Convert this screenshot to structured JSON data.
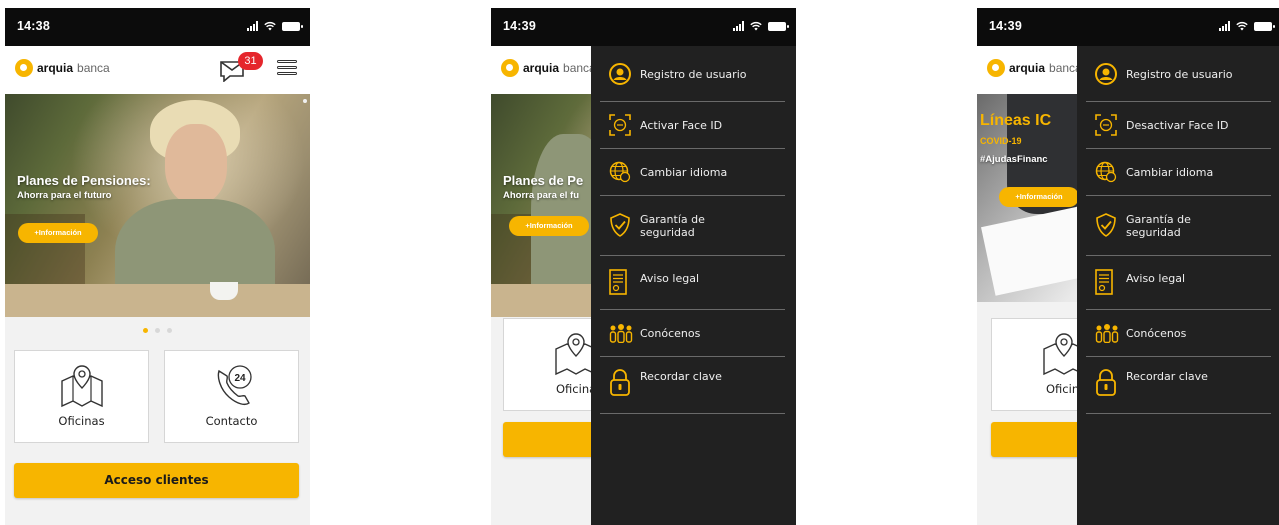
{
  "colors": {
    "accent": "#f7b500",
    "drawer": "#212121",
    "badge": "#e5262c"
  },
  "screens": [
    {
      "status_time": "14:38",
      "brand": {
        "bold": "arquia",
        "light": "banca"
      },
      "mail_badge": "31",
      "banner": {
        "title": "Planes de Pensiones:",
        "subtitle": "Ahorra para el futuro",
        "button": "+Información"
      },
      "tiles": [
        {
          "label": "Oficinas",
          "icon": "map-pin-icon"
        },
        {
          "label": "Contacto",
          "icon": "phone-24-icon"
        }
      ],
      "cta": "Acceso clientes"
    },
    {
      "status_time": "14:39",
      "brand": {
        "bold": "arquia",
        "light": "banca"
      },
      "banner": {
        "title": "Planes de Pe",
        "subtitle": "Ahorra para el fu",
        "button": "+Información"
      },
      "tiles": [
        {
          "label": "Oficinas"
        }
      ],
      "menu": [
        {
          "label": "Registro de usuario",
          "icon": "user-circle-icon"
        },
        {
          "label": "Activar Face ID",
          "icon": "face-id-icon"
        },
        {
          "label": "Cambiar idioma",
          "icon": "globe-icon"
        },
        {
          "label": "Garantía de\nseguridad",
          "icon": "shield-check-icon"
        },
        {
          "label": "Aviso legal",
          "icon": "document-icon"
        },
        {
          "label": "Conócenos",
          "icon": "people-icon"
        },
        {
          "label": "Recordar clave",
          "icon": "lock-icon"
        }
      ]
    },
    {
      "status_time": "14:39",
      "brand": {
        "bold": "arquia",
        "light": "banca"
      },
      "banner": {
        "title": "Líneas IC",
        "line2": "COVID-19",
        "subtitle": "#AjudasFinanc",
        "button": "+Información"
      },
      "tiles": [
        {
          "label": "Oficinas"
        }
      ],
      "menu": [
        {
          "label": "Registro de usuario",
          "icon": "user-circle-icon"
        },
        {
          "label": "Desactivar Face ID",
          "icon": "face-id-icon"
        },
        {
          "label": "Cambiar idioma",
          "icon": "globe-icon"
        },
        {
          "label": "Garantía de\nseguridad",
          "icon": "shield-check-icon"
        },
        {
          "label": "Aviso legal",
          "icon": "document-icon"
        },
        {
          "label": "Conócenos",
          "icon": "people-icon"
        },
        {
          "label": "Recordar clave",
          "icon": "lock-icon"
        }
      ]
    }
  ]
}
